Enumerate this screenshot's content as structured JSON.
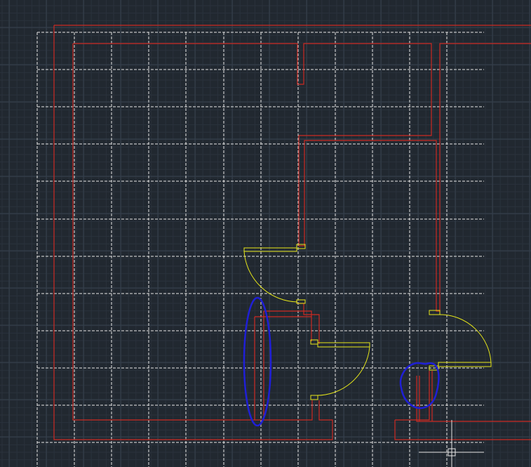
{
  "app": {
    "type": "cad-drawing-viewport"
  },
  "colors": {
    "background": "#212830",
    "background_grid_minor": "#2a323c",
    "background_grid_major": "#35404c",
    "dashed_grid": "#e6e6e6",
    "walls": "#cc2a22",
    "doors": "#e6e61a",
    "markup": "#1f1fd6",
    "cursor": "#e6e6e6"
  },
  "icons": {
    "cursor": "crosshair-pickbox-icon"
  }
}
